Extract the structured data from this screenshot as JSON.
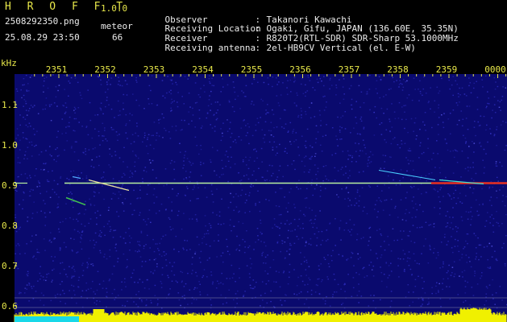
{
  "header": {
    "brand": "H R O F F T",
    "version": "1.0.0",
    "filename": "2508292350.png",
    "datetime": "25.08.29 23:50",
    "meteor_label": "meteor",
    "meteor_count": "66"
  },
  "info": [
    {
      "label": "Observer",
      "sep": ":",
      "value": "Takanori Kawachi"
    },
    {
      "label": "Receiving Location",
      "sep": ":",
      "value": "Ogaki, Gifu, JAPAN (136.60E, 35.35N)"
    },
    {
      "label": "Receiver",
      "sep": ":",
      "value": "R820T2(RTL-SDR) SDR-Sharp 53.1000MHz"
    },
    {
      "label": "Receiving antenna",
      "sep": ":",
      "value": "2el-HB9CV Vertical (el. E-W)"
    }
  ],
  "chart_data": {
    "type": "heatmap",
    "x_tick_labels": [
      "2351",
      "2352",
      "2353",
      "2354",
      "2355",
      "2356",
      "2357",
      "2358",
      "2359",
      "0000"
    ],
    "y_unit": "kHz",
    "y_tick_labels": [
      "1.1",
      "1.0",
      "0.9",
      "0.8",
      "0.7",
      "0.6"
    ],
    "ylim": [
      0.6,
      1.15
    ],
    "carrier_khz": 0.905,
    "colors": {
      "background": "#0a0a6e",
      "noise": "#2a2ab8",
      "carrier": "#b8f0a0",
      "strong": "#e83020",
      "baseline": "#18d8e8",
      "peaks": "#f0f000",
      "axis_text": "#e8e84a",
      "tick": "#e8e84a"
    }
  }
}
